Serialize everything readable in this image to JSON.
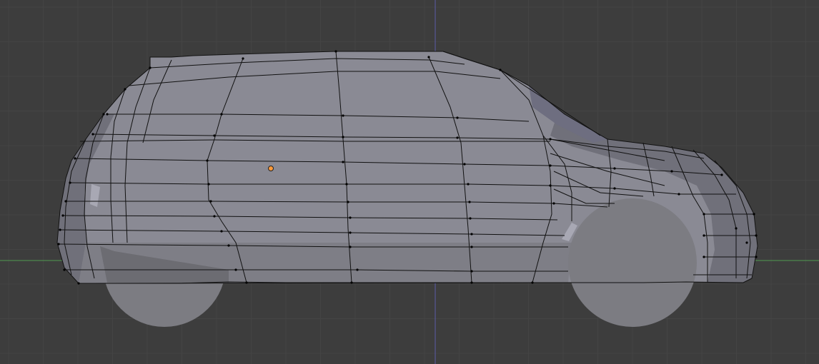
{
  "viewport": {
    "view": "side-orthographic",
    "mode": "edit",
    "background_color": "#3d3d3d",
    "grid_minor_color": "#444444",
    "grid_major_color": "#4a4a4a",
    "x_axis_color": "#4f9a4f",
    "z_axis_color": "#5a5aa8",
    "origin_marker_color": "#ff9a3a"
  },
  "object": {
    "name_icon": "car-mesh-icon",
    "type": "mesh",
    "shading": "solid",
    "body_color": "#8a8a94",
    "body_dark_color": "#70707a",
    "body_light_color": "#a8a8b4",
    "wheel_color": "#7c7c82",
    "edge_color": "#111111"
  }
}
